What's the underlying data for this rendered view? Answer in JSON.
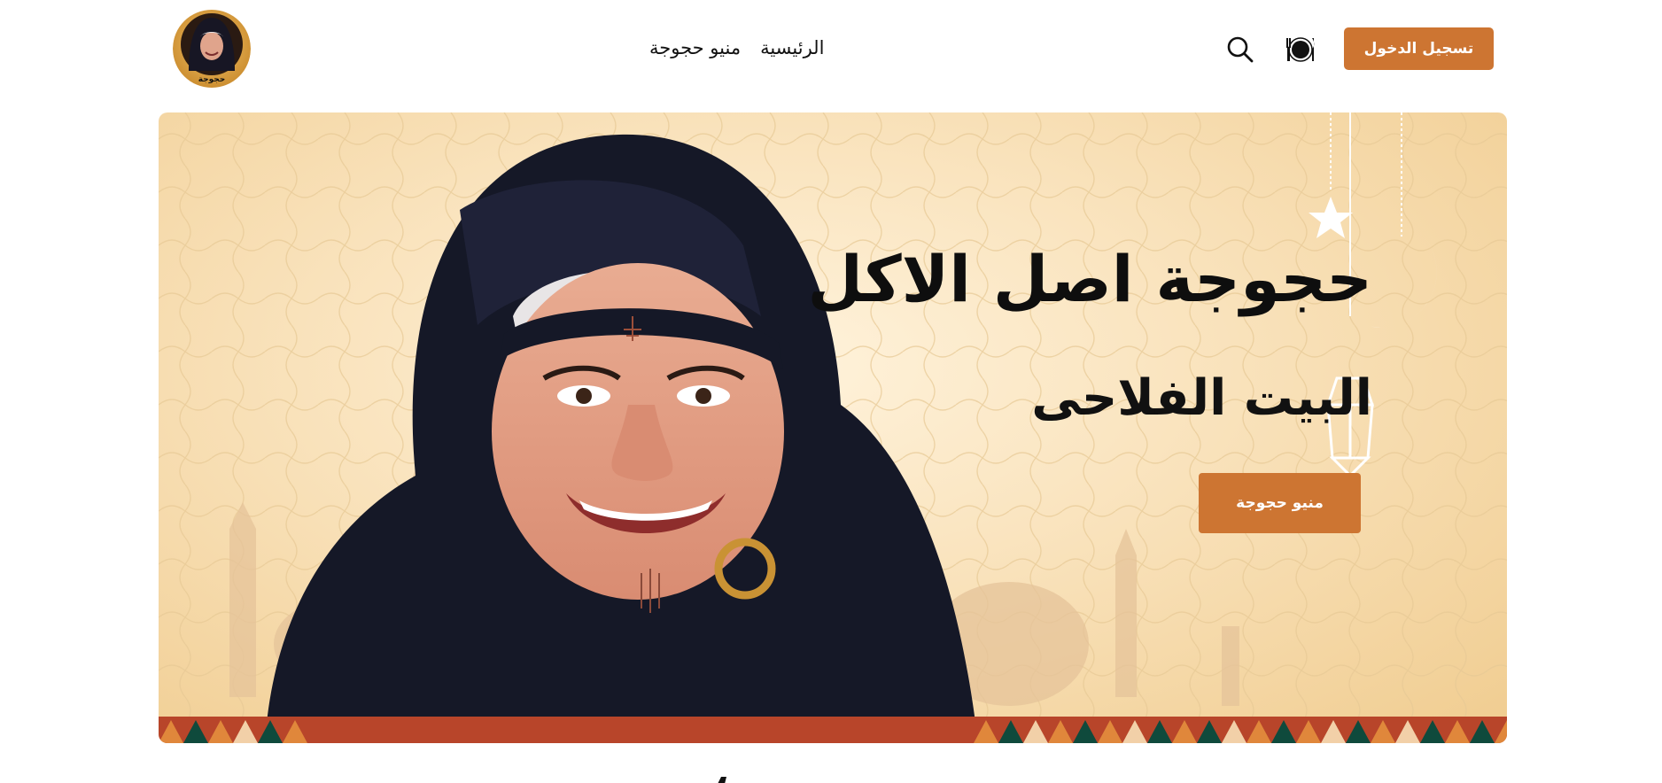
{
  "header": {
    "login_label": "تسجيل الدخول",
    "nav": [
      {
        "label": "الرئيسية"
      },
      {
        "label": "منيو حجوجة"
      }
    ],
    "icons": {
      "menu": "dish-icon",
      "search": "search-icon"
    },
    "logo_text": "حجوجة"
  },
  "hero": {
    "title": "حجوجة اصل الاكل",
    "subtitle": "البيت الفلاحى",
    "button_label": "منيو حجوجة"
  },
  "colors": {
    "accent": "#cd7532",
    "hero_bg": "#f9e2bb",
    "hijab": "#151827",
    "pattern_green": "#0f4a3c",
    "pattern_orange": "#e0873b",
    "pattern_red": "#b8452a"
  }
}
